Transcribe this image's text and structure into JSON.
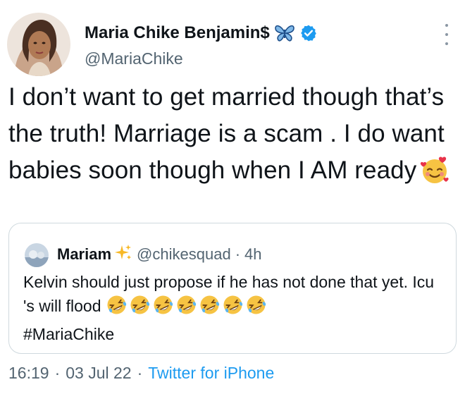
{
  "author": {
    "display_name": "Maria Chike Benjamin$",
    "handle": "@MariaChike",
    "verified": true,
    "name_decoration_icon": "butterfly-icon"
  },
  "tweet": {
    "text_before_emoji": "I don’t want to get married though that’s the truth! Marriage is a scam . I do want babies soon though when I AM  ready",
    "emoji": "smiling-face-with-hearts-icon"
  },
  "quoted_tweet": {
    "name": "Mariam",
    "name_decoration_icon": "sparkles-icon",
    "handle": "@chikesquad",
    "separator": "·",
    "time": "4h",
    "text": "Kelvin should just propose if he has not done that yet. Icu 's will flood",
    "emoji_count": 7,
    "emoji": "rolling-on-floor-laughing-icon",
    "hashtag": "#MariaChike"
  },
  "meta": {
    "time": "16:19",
    "separator": "·",
    "date": "03 Jul 22",
    "source": "Twitter for iPhone"
  },
  "colors": {
    "text": "#0f1419",
    "secondary": "#536471",
    "link": "#1d9bf0",
    "verified": "#1d9bf0",
    "border": "#cfd9de"
  }
}
